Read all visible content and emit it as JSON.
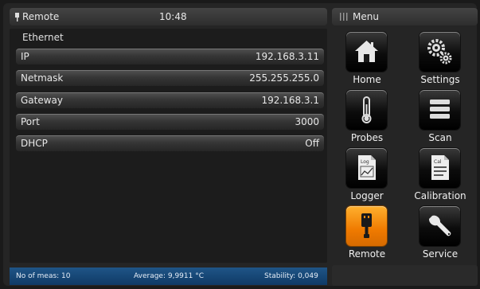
{
  "header": {
    "mode_label": "Remote",
    "time": "10:48",
    "menu_label": "Menu"
  },
  "ethernet": {
    "title": "Ethernet",
    "fields": [
      {
        "label": "IP",
        "value": "192.168.3.11"
      },
      {
        "label": "Netmask",
        "value": "255.255.255.0"
      },
      {
        "label": "Gateway",
        "value": "192.168.3.1"
      },
      {
        "label": "Port",
        "value": "3000"
      },
      {
        "label": "DHCP",
        "value": "Off"
      }
    ]
  },
  "status": {
    "meas": "No of meas: 10",
    "average": "Average: 9,9911 °C",
    "stability": "Stability: 0,049"
  },
  "menu": {
    "items": [
      {
        "label": "Home",
        "icon": "home-icon",
        "active": false
      },
      {
        "label": "Settings",
        "icon": "settings-icon",
        "active": false
      },
      {
        "label": "Probes",
        "icon": "thermometer-icon",
        "active": false
      },
      {
        "label": "Scan",
        "icon": "scan-icon",
        "active": false
      },
      {
        "label": "Logger",
        "icon": "logger-icon",
        "active": false
      },
      {
        "label": "Calibration",
        "icon": "calibration-icon",
        "active": false
      },
      {
        "label": "Remote",
        "icon": "remote-plug-icon",
        "active": true
      },
      {
        "label": "Service",
        "icon": "wrench-icon",
        "active": false
      }
    ]
  },
  "colors": {
    "active_accent": "#f28a0c",
    "status_bar": "#1a4d80"
  }
}
